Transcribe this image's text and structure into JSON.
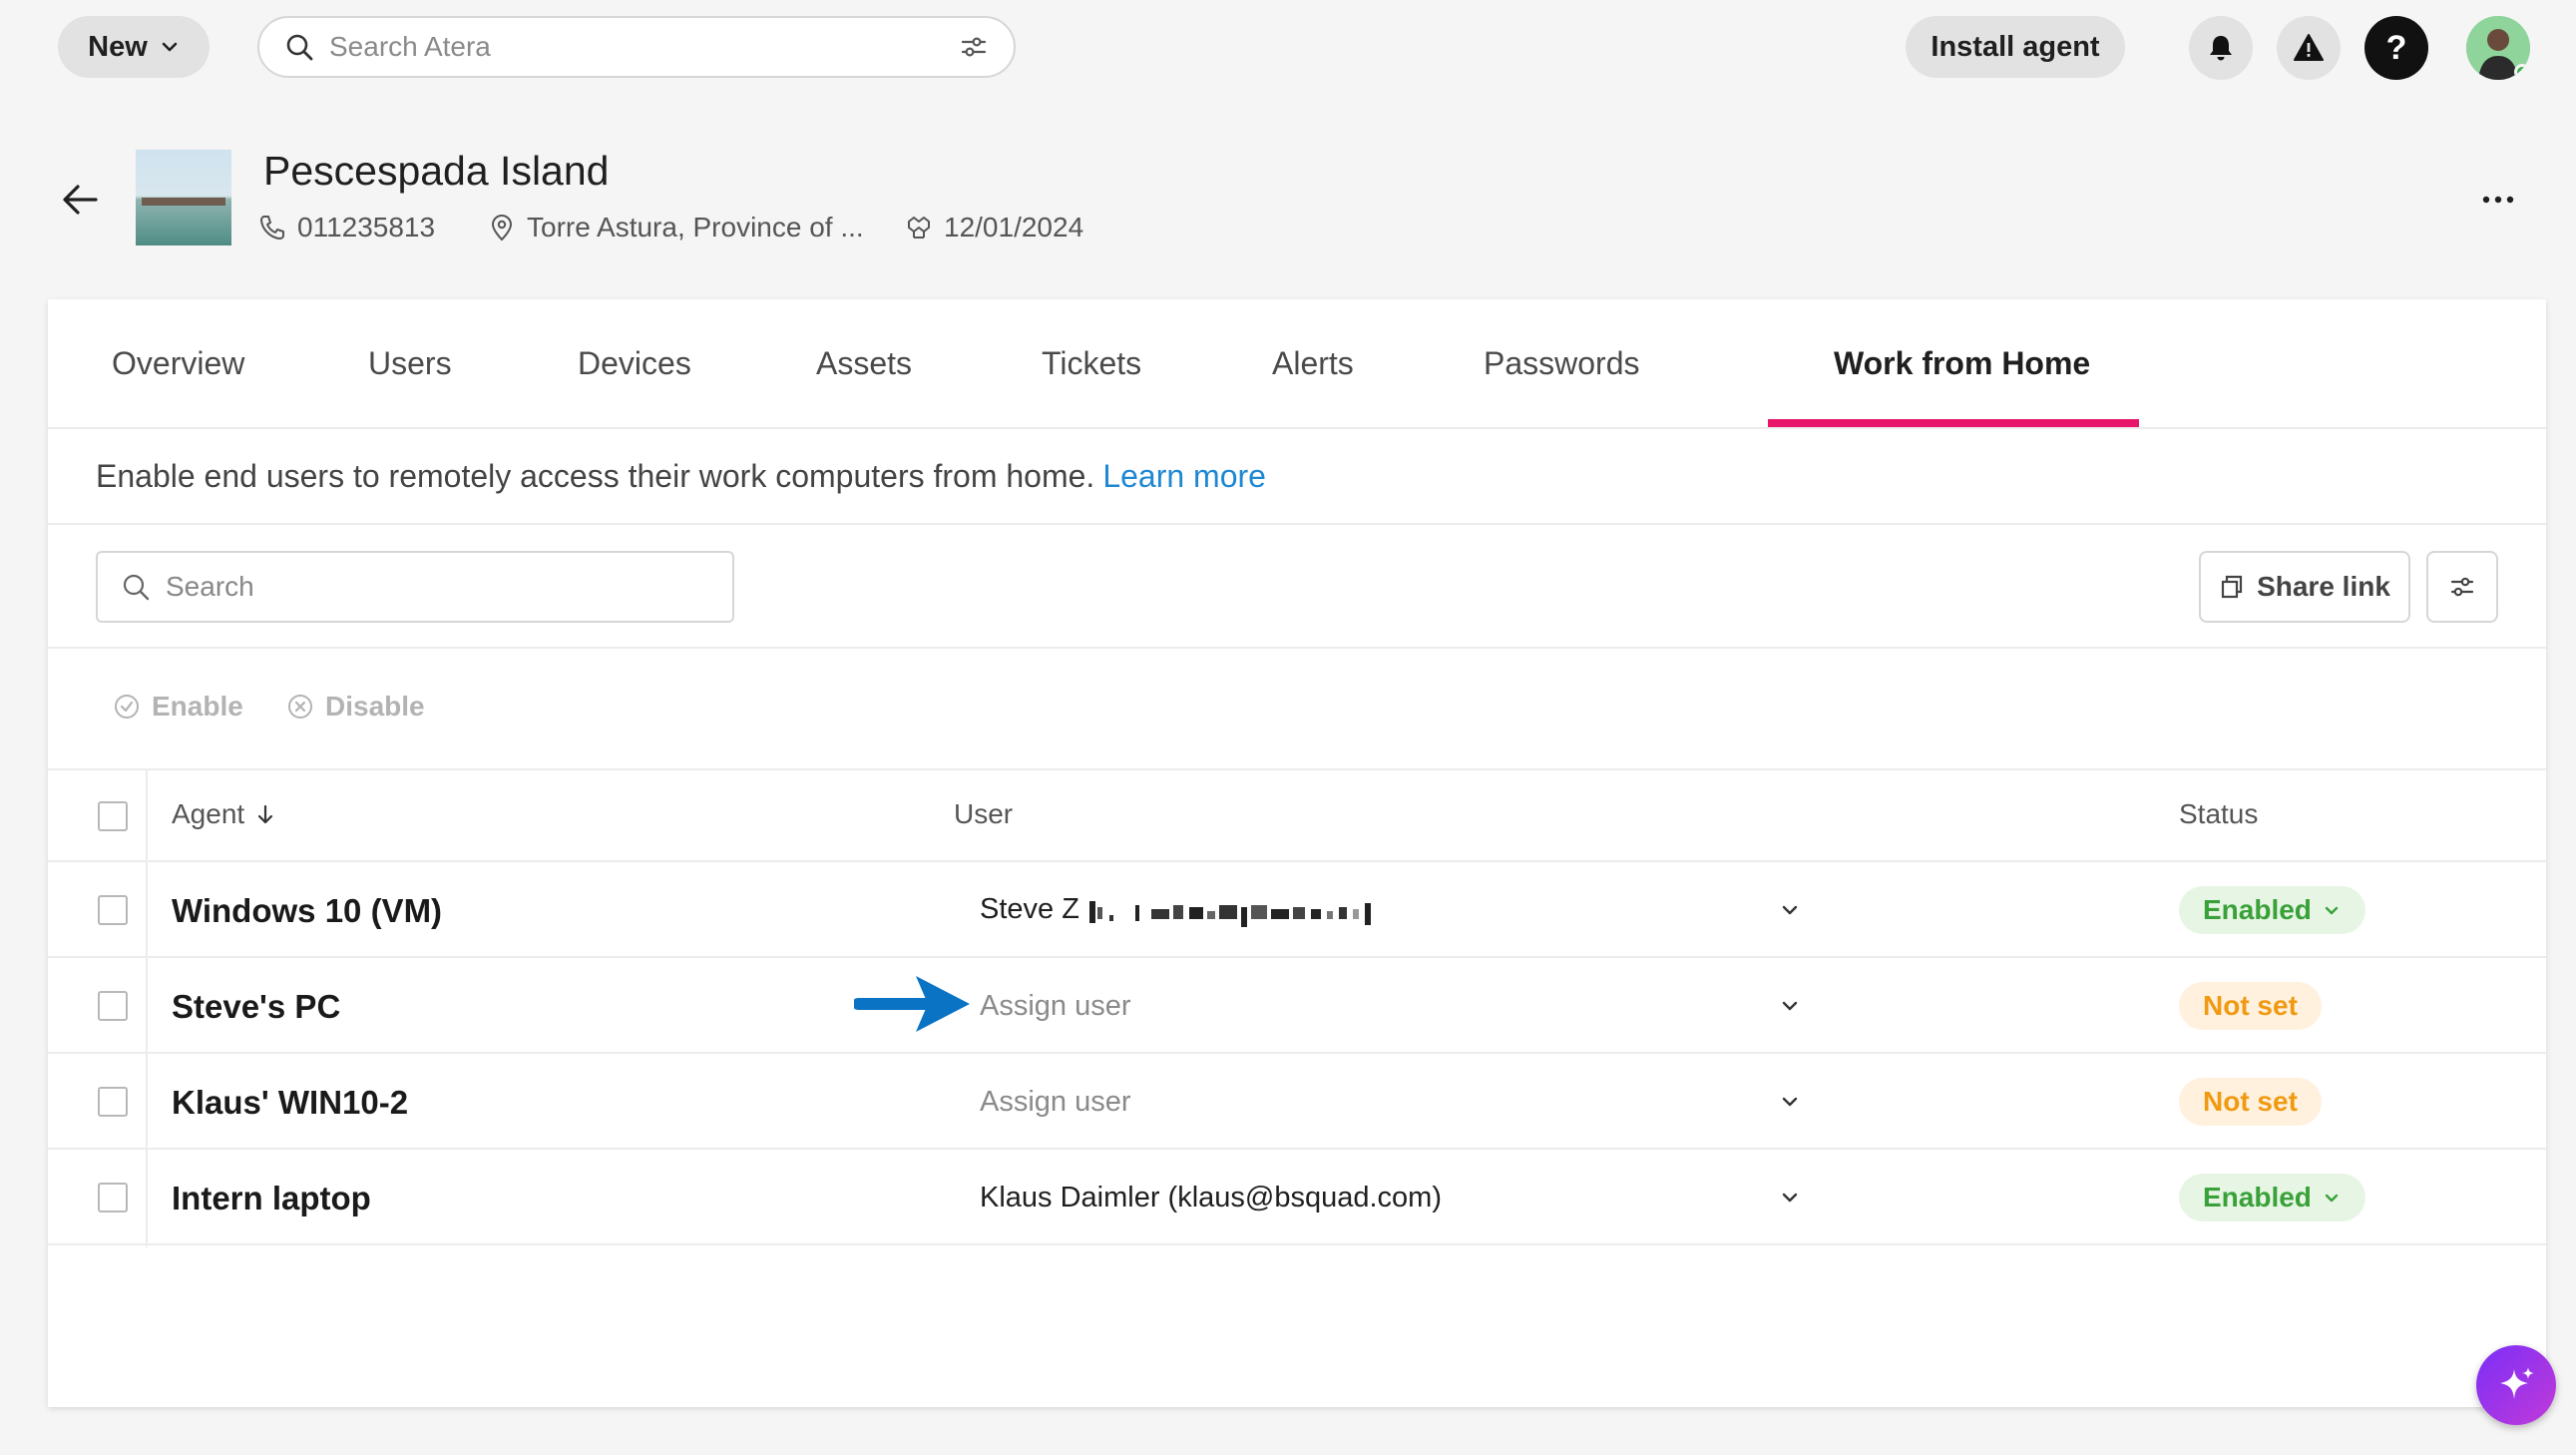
{
  "topbar": {
    "new_label": "New",
    "search_placeholder": "Search Atera",
    "install_label": "Install agent",
    "help_glyph": "?"
  },
  "customer": {
    "name": "Pescespada Island",
    "phone": "011235813",
    "location": "Torre Astura, Province of ...",
    "created": "12/01/2024"
  },
  "tabs": [
    {
      "label": "Overview"
    },
    {
      "label": "Users"
    },
    {
      "label": "Devices"
    },
    {
      "label": "Assets"
    },
    {
      "label": "Tickets"
    },
    {
      "label": "Alerts"
    },
    {
      "label": "Passwords"
    },
    {
      "label": "Work from Home",
      "active": true
    }
  ],
  "info": {
    "text": "Enable end users to remotely access their work computers from home.",
    "link": "Learn more"
  },
  "toolbar": {
    "search_placeholder": "Search",
    "share_label": "Share link",
    "enable_label": "Enable",
    "disable_label": "Disable"
  },
  "table": {
    "headers": {
      "agent": "Agent",
      "user": "User",
      "status": "Status"
    },
    "rows": [
      {
        "agent": "Windows 10 (VM)",
        "user": "Steve Z",
        "user_redacted": true,
        "status": "Enabled"
      },
      {
        "agent": "Steve's PC",
        "user": "Assign user",
        "status": "Not set"
      },
      {
        "agent": "Klaus' WIN10-2",
        "user": "Assign user",
        "status": "Not set"
      },
      {
        "agent": "Intern laptop",
        "user": "Klaus Daimler (klaus@bsquad.com)",
        "status": "Enabled"
      }
    ]
  },
  "colors": {
    "accent_tab": "#e8166a",
    "link": "#1e88d3",
    "enabled_text": "#3aa13a",
    "notset_text": "#f09a12",
    "pointer_arrow": "#0a73c4"
  }
}
